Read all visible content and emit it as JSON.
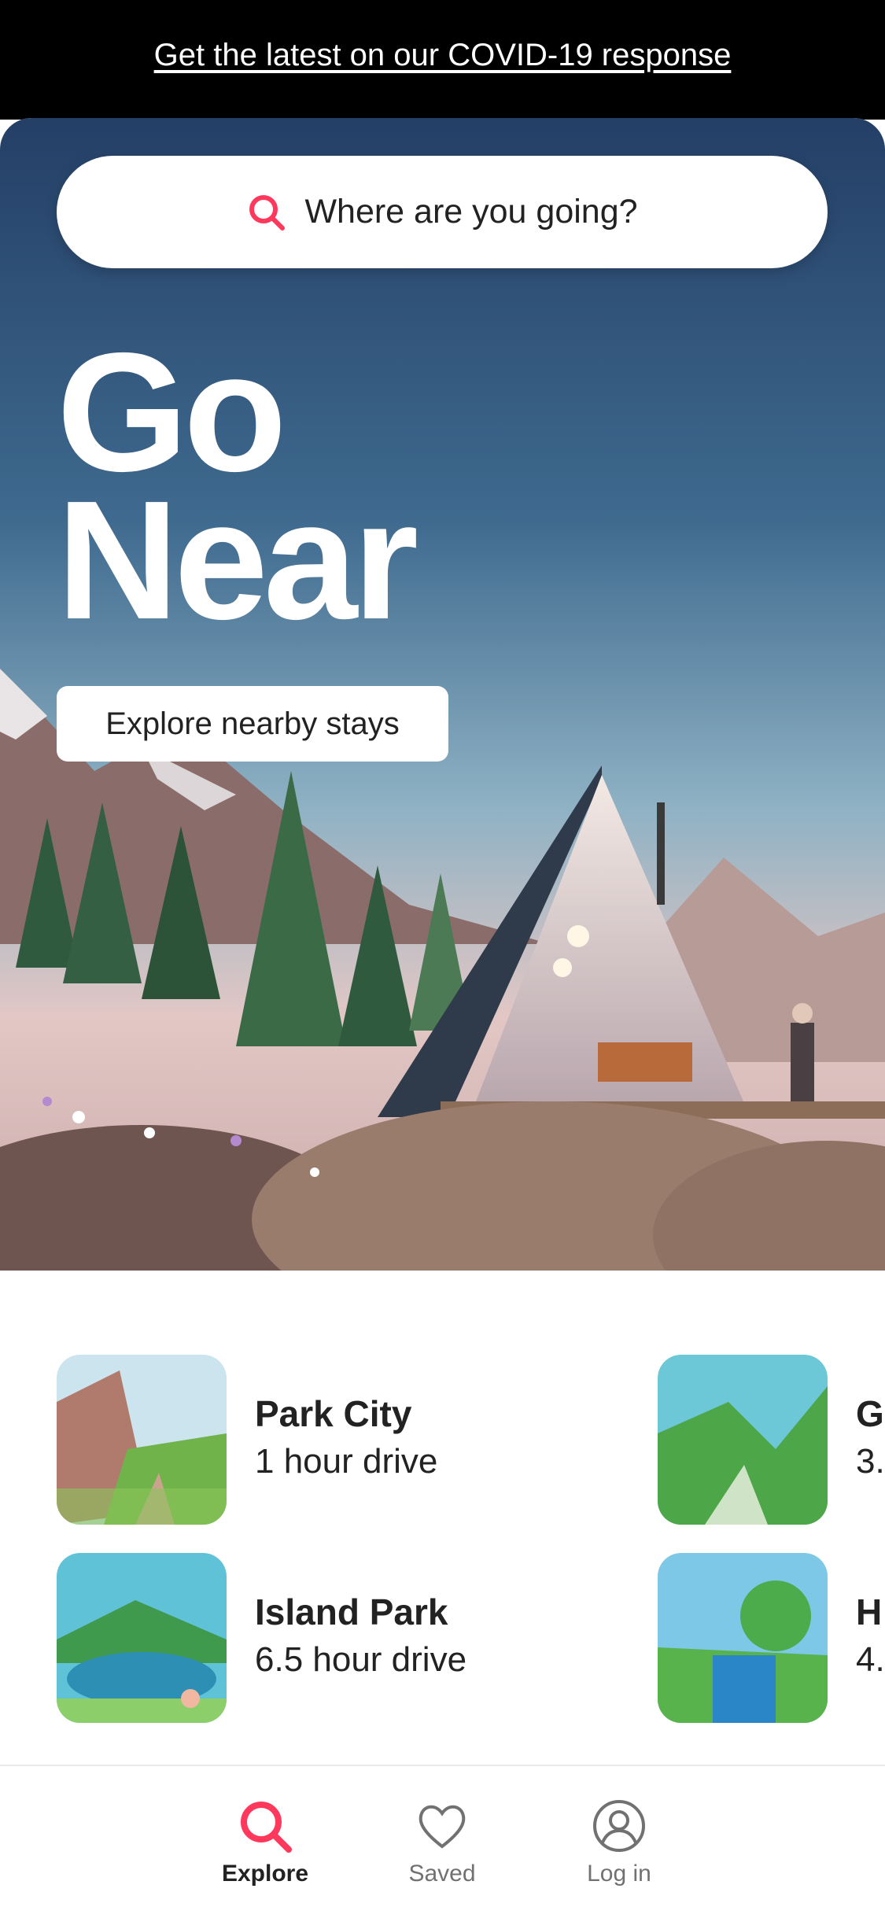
{
  "banner": {
    "link_text": "Get the latest on our COVID-19 response"
  },
  "search": {
    "placeholder": "Where are you going?",
    "icon": "search-icon"
  },
  "hero": {
    "headline_line1": "Go",
    "headline_line2": "Near",
    "cta_label": "Explore nearby stays"
  },
  "destinations": [
    {
      "name": "Park City",
      "drive": "1 hour drive"
    },
    {
      "name": "Island Park",
      "drive": "6.5 hour drive"
    },
    {
      "name": "G",
      "drive": "3."
    },
    {
      "name": "H",
      "drive": "4."
    }
  ],
  "nav": {
    "items": [
      {
        "label": "Explore",
        "icon": "search-icon",
        "active": true
      },
      {
        "label": "Saved",
        "icon": "heart-icon",
        "active": false
      },
      {
        "label": "Log in",
        "icon": "profile-icon",
        "active": false
      }
    ]
  },
  "colors": {
    "accent": "#FF385C",
    "inactive": "#717171",
    "text": "#222222"
  }
}
